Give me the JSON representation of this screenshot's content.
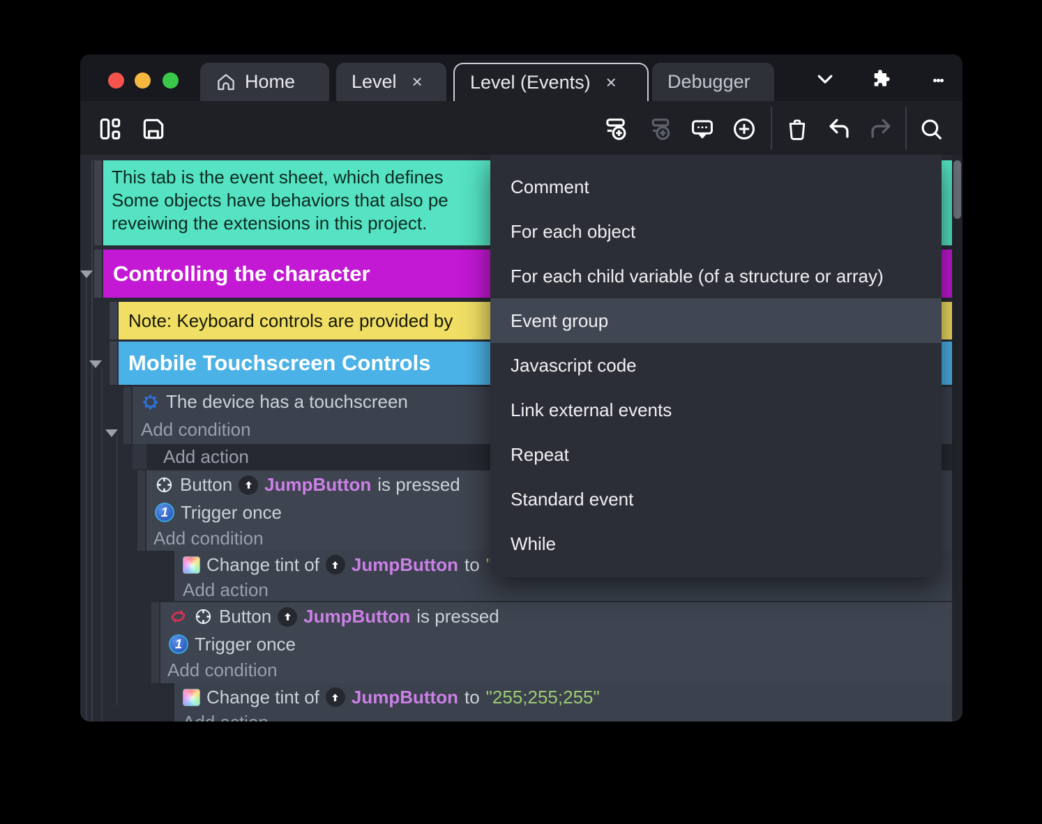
{
  "titlebar": {
    "traffic_lights": {
      "close": "#f5544d",
      "minimize": "#f6b73e",
      "zoom": "#3ac84b"
    },
    "tabs": [
      {
        "label": "Home",
        "icon": "home",
        "active": false,
        "closable": false
      },
      {
        "label": "Level",
        "active": false,
        "closable": true
      },
      {
        "label": "Level (Events)",
        "active": true,
        "closable": true
      },
      {
        "label": "Debugger",
        "active": false,
        "closable": false
      }
    ],
    "close_glyph": "×"
  },
  "toolbar": {
    "icons": [
      "panels",
      "save",
      "play",
      "play-dropdown",
      "preview-globe",
      "add-event",
      "add-subevent",
      "add-comment",
      "add-circle",
      "delete",
      "undo",
      "redo",
      "search"
    ],
    "accent_color": "#5134d8"
  },
  "menu": {
    "items": [
      "Comment",
      "For each object",
      "For each child variable (of a structure or array)",
      "Event group",
      "Javascript code",
      "Link external events",
      "Repeat",
      "Standard event",
      "While"
    ],
    "highlighted_item": "Event group",
    "highlight_color": "#414653"
  },
  "sheet": {
    "comment": {
      "lines": [
        "This tab is the event sheet, which defines",
        "Some objects have behaviors that also pe",
        "reveiwing the extensions in this project."
      ],
      "bg": "#55e3c3"
    },
    "group_controlling": {
      "title": "Controlling the character",
      "bg": "#c318d4"
    },
    "note": {
      "text": "Note: Keyboard controls are provided by",
      "bg": "#f0df64"
    },
    "group_mobile": {
      "title": "Mobile Touchscreen Controls",
      "bg": "#4bb2e8"
    },
    "labels": {
      "add_condition": "Add condition",
      "add_action": "Add action"
    },
    "touch_event": {
      "condition": "The device has a touchscreen"
    },
    "button_event": {
      "button_word": "Button",
      "object": "JumpButton",
      "suffix": "is pressed",
      "trigger_once": "Trigger once"
    },
    "tint_action": {
      "prefix": "Change tint of",
      "object": "JumpButton",
      "to_word": "to",
      "value": "\"255;255;255\""
    },
    "colors": {
      "event_row_bg": "#3e4450",
      "object_text": "#cb80e6",
      "string_text": "#9ccb72",
      "condition_icon_blue": "#2f6fd6",
      "invert_icon_red": "#d63158"
    }
  }
}
